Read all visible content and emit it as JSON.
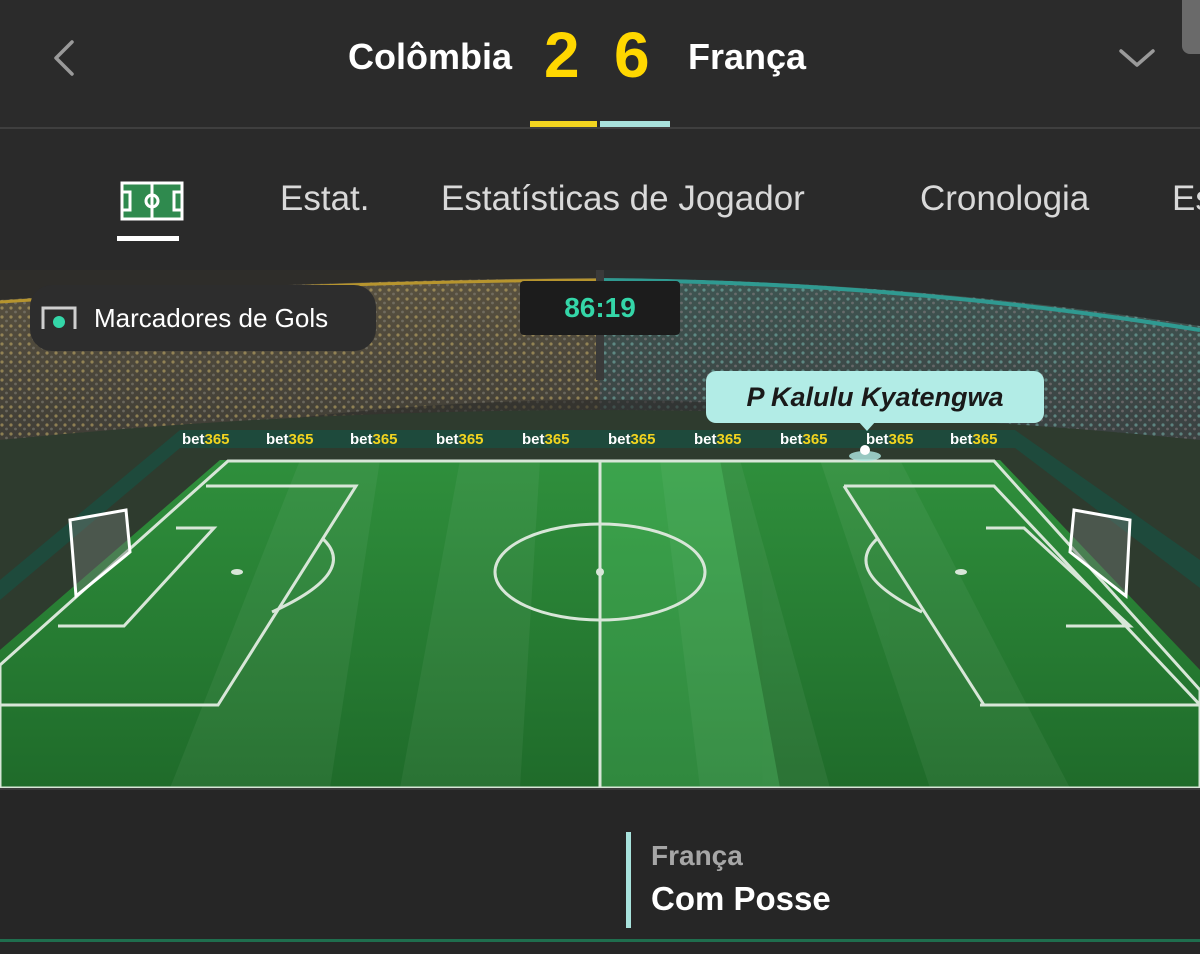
{
  "header": {
    "home_team": "Colômbia",
    "away_team": "França",
    "home_score": "2",
    "away_score": "6",
    "home_color": "#f2d41f",
    "away_color": "#a8e2dc"
  },
  "tabs": [
    {
      "icon": "pitch-icon",
      "active": true
    },
    {
      "label": "Estat."
    },
    {
      "label": "Estatísticas de Jogador"
    },
    {
      "label": "Cronologia"
    },
    {
      "label": "Es"
    }
  ],
  "pitch": {
    "scorers_label": "Marcadores de Gols",
    "clock": "86:19",
    "player_name": "P Kalulu Kyatengwa",
    "board_text": "bet365"
  },
  "possession": {
    "team": "França",
    "status": "Com Posse"
  }
}
